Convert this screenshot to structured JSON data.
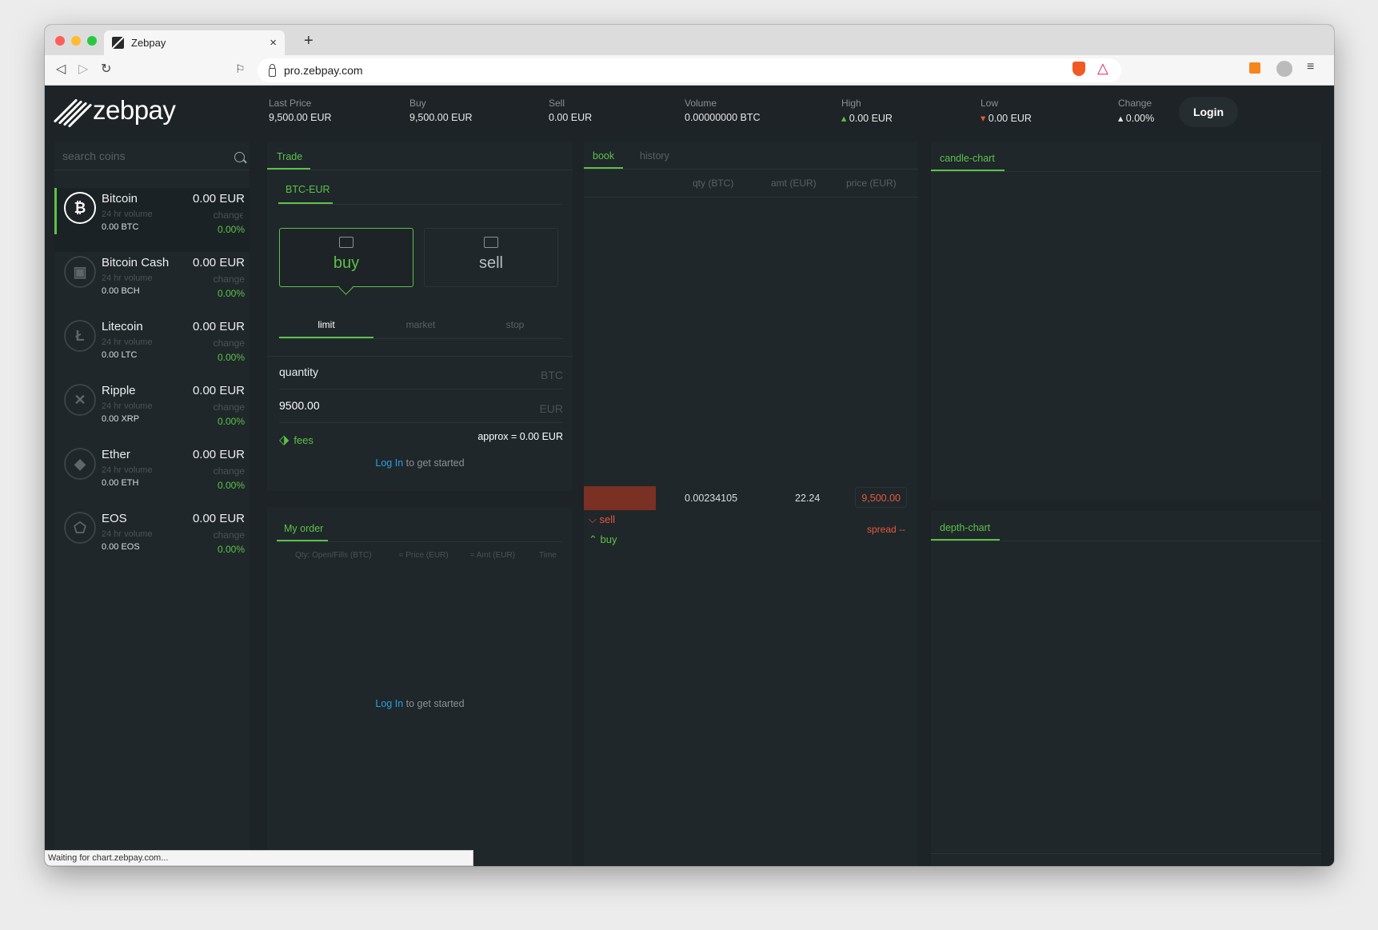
{
  "browser": {
    "tab_title": "Zebpay",
    "url": "pro.zebpay.com",
    "status": "Waiting for chart.zebpay.com..."
  },
  "header": {
    "logo_text": "zebpay",
    "stats": [
      {
        "label": "Last Price",
        "value": "9,500.00 EUR"
      },
      {
        "label": "Buy",
        "value": "9,500.00 EUR"
      },
      {
        "label": "Sell",
        "value": "0.00 EUR"
      },
      {
        "label": "Volume",
        "value": "0.00000000 BTC"
      },
      {
        "label": "High",
        "value": "0.00 EUR"
      },
      {
        "label": "Low",
        "value": "0.00 EUR"
      },
      {
        "label": "Change",
        "value": "0.00%"
      }
    ],
    "login_label": "Login"
  },
  "sidebar": {
    "search_placeholder": "search coins",
    "coins": [
      {
        "name": "Bitcoin",
        "price": "0.00 EUR",
        "volume_label": "24 hr volume",
        "change_label": "change",
        "amount": "0.00 BTC",
        "change": "0.00%",
        "icon": "bitcoin-icon"
      },
      {
        "name": "Bitcoin Cash",
        "price": "0.00 EUR",
        "volume_label": "24 hr volume",
        "change_label": "change",
        "amount": "0.00 BCH",
        "change": "0.00%",
        "icon": "bitcoin-cash-icon"
      },
      {
        "name": "Litecoin",
        "price": "0.00 EUR",
        "volume_label": "24 hr volume",
        "change_label": "change",
        "amount": "0.00 LTC",
        "change": "0.00%",
        "icon": "litecoin-icon"
      },
      {
        "name": "Ripple",
        "price": "0.00 EUR",
        "volume_label": "24 hr volume",
        "change_label": "change",
        "amount": "0.00 XRP",
        "change": "0.00%",
        "icon": "ripple-icon"
      },
      {
        "name": "Ether",
        "price": "0.00 EUR",
        "volume_label": "24 hr volume",
        "change_label": "change",
        "amount": "0.00 ETH",
        "change": "0.00%",
        "icon": "ether-icon"
      },
      {
        "name": "EOS",
        "price": "0.00 EUR",
        "volume_label": "24 hr volume",
        "change_label": "change",
        "amount": "0.00 EOS",
        "change": "0.00%",
        "icon": "eos-icon"
      }
    ]
  },
  "trade": {
    "tab": "Trade",
    "pair": "BTC-EUR",
    "buy_label": "buy",
    "sell_label": "sell",
    "order_types": [
      "limit",
      "market",
      "stop"
    ],
    "quantity_label": "quantity",
    "quantity_unit": "BTC",
    "price_value": "9500.00",
    "price_unit": "EUR",
    "fees_label": "fees",
    "approx": "approx = 0.00 EUR",
    "login_link": "Log In",
    "login_suffix": " to get started"
  },
  "my_order": {
    "tab": "My order",
    "columns": [
      "Qty: Open/Fills (BTC)",
      "≈ Price (EUR)",
      "≈ Amt (EUR)",
      "Time"
    ],
    "login_link": "Log In",
    "login_suffix": " to get started"
  },
  "book": {
    "tabs": [
      "book",
      "history"
    ],
    "columns": [
      "qty (BTC)",
      "amt (EUR)",
      "price (EUR)"
    ],
    "row": {
      "qty": "0.00234105",
      "amt": "22.24",
      "price": "9,500.00"
    },
    "sell_label": "sell",
    "buy_label": "buy",
    "spread_label": "spread --"
  },
  "charts": {
    "candle_tab": "candle-chart",
    "depth_tab": "depth-chart"
  },
  "colors": {
    "accent_green": "#5cc247",
    "sell_red": "#e5583d",
    "link_blue": "#2f9fe3",
    "background": "#1d2326"
  }
}
